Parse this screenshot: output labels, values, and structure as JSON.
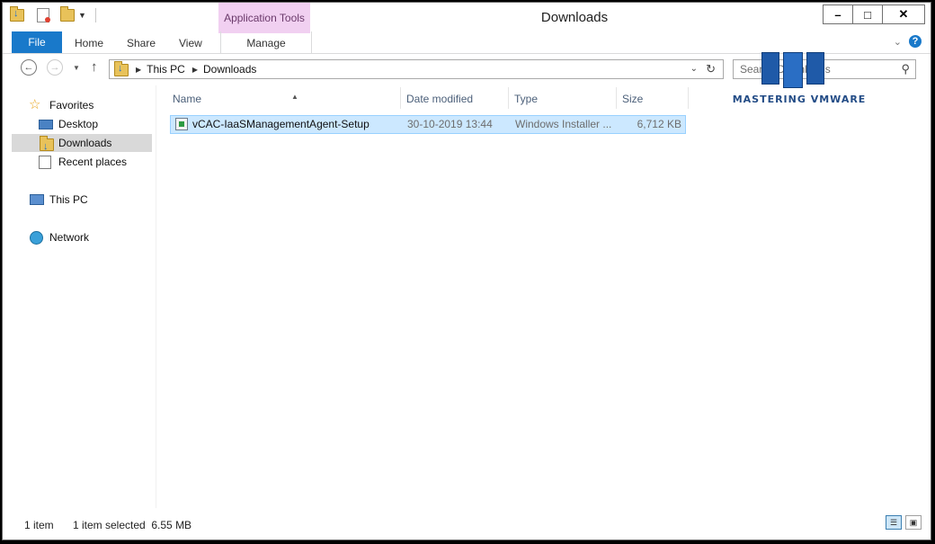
{
  "window": {
    "title": "Downloads"
  },
  "quick_access": {
    "icons": [
      "downloads-folder-icon",
      "properties-icon",
      "new-folder-icon",
      "customize-dropdown-icon"
    ]
  },
  "ribbon": {
    "file_label": "File",
    "tabs": [
      "Home",
      "Share",
      "View"
    ],
    "context_group": "Application Tools",
    "context_tab": "Manage"
  },
  "address_bar": {
    "crumbs": [
      "This PC",
      "Downloads"
    ]
  },
  "search": {
    "placeholder": "Search Downloads"
  },
  "nav_pane": {
    "favorites": "Favorites",
    "favorites_items": [
      "Desktop",
      "Downloads",
      "Recent places"
    ],
    "selected": "Downloads",
    "this_pc": "This PC",
    "network": "Network"
  },
  "columns": [
    "Name",
    "Date modified",
    "Type",
    "Size"
  ],
  "files": [
    {
      "name": "vCAC-IaaSManagementAgent-Setup",
      "date": "30-10-2019 13:44",
      "type": "Windows Installer ...",
      "size": "6,712 KB"
    }
  ],
  "status": {
    "count": "1 item",
    "selection": "1 item selected  6.55 MB"
  },
  "watermark": {
    "text": "MASTERING VMWARE"
  },
  "colors": {
    "accent": "#1979ca",
    "context_tab": "#f1d0f1",
    "selection": "#cce8ff"
  }
}
